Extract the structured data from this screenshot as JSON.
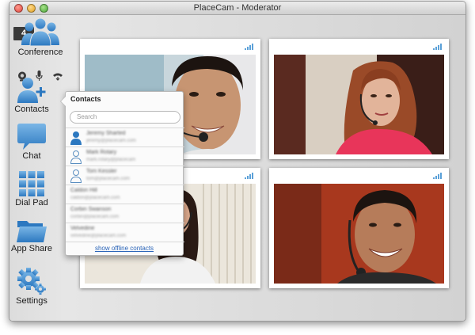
{
  "window": {
    "title": "PlaceCam - Moderator"
  },
  "sidebar": {
    "badge_count": "4",
    "items": [
      {
        "label": "Conference",
        "icon": "conference-icon"
      },
      {
        "label": "Contacts",
        "icon": "add-contact-icon"
      },
      {
        "label": "Chat",
        "icon": "chat-icon"
      },
      {
        "label": "Dial Pad",
        "icon": "dialpad-icon"
      },
      {
        "label": "App Share",
        "icon": "folder-icon"
      },
      {
        "label": "Settings",
        "icon": "gear-icon"
      }
    ],
    "controls": [
      "webcam-icon",
      "microphone-icon",
      "phone-hangup-icon"
    ]
  },
  "contacts_popover": {
    "title": "Contacts",
    "search_placeholder": "Search",
    "contacts": [
      {
        "name": "Jeremy Sharted",
        "status": "jeremy@placecam.com",
        "online": true
      },
      {
        "name": "Mark Rotary",
        "status": "mark.rotary@placecam",
        "online": false
      },
      {
        "name": "Tom Kessler",
        "status": "tom@placecam.com",
        "online": false
      },
      {
        "name": "Caldon Hill",
        "status": "caldon@placecam.com",
        "online": false
      },
      {
        "name": "Corbin Swanson",
        "status": "corbin@placecam.com",
        "online": false
      },
      {
        "name": "Velvedine",
        "status": "velvedine@placecam.com",
        "online": false
      }
    ],
    "show_offline_label": "show offline contacts"
  },
  "colors": {
    "accent": "#5aa0d8",
    "link": "#2a64b8"
  }
}
